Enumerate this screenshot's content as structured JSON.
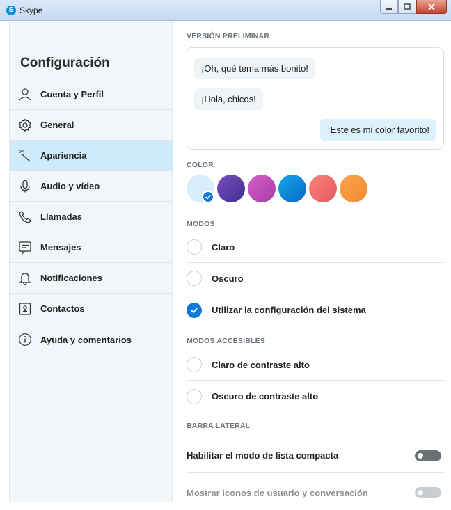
{
  "window": {
    "title": "Skype",
    "logo_letter": "S"
  },
  "sidebar": {
    "title": "Configuración",
    "items": [
      {
        "label": "Cuenta y Perfil",
        "icon": "person-icon"
      },
      {
        "label": "General",
        "icon": "gear-icon"
      },
      {
        "label": "Apariencia",
        "icon": "magic-wand-icon",
        "active": true
      },
      {
        "label": "Audio y vídeo",
        "icon": "microphone-icon"
      },
      {
        "label": "Llamadas",
        "icon": "phone-icon"
      },
      {
        "label": "Mensajes",
        "icon": "message-icon"
      },
      {
        "label": "Notificaciones",
        "icon": "bell-icon"
      },
      {
        "label": "Contactos",
        "icon": "contact-card-icon"
      },
      {
        "label": "Ayuda y comentarios",
        "icon": "info-icon"
      }
    ]
  },
  "preview": {
    "label": "VERSIÓN PRELIMINAR",
    "messages": [
      {
        "text": "¡Oh, qué tema más bonito!",
        "direction": "in"
      },
      {
        "text": "¡Hola, chicos!",
        "direction": "in"
      },
      {
        "text": "¡Este es mi color favorito!",
        "direction": "out"
      }
    ]
  },
  "color": {
    "label": "COLOR",
    "swatches": [
      {
        "color": "#d9eefb",
        "selected": true
      },
      {
        "color": "#5b3fa8"
      },
      {
        "color": "#c24cb8"
      },
      {
        "color": "#0a87d8"
      },
      {
        "color": "#ee6b6b"
      },
      {
        "color": "#f5973e"
      }
    ]
  },
  "modes": {
    "label": "MODOS",
    "options": [
      {
        "label": "Claro",
        "checked": false
      },
      {
        "label": "Oscuro",
        "checked": false
      },
      {
        "label": "Utilizar la configuración del sistema",
        "checked": true
      }
    ]
  },
  "accessible_modes": {
    "label": "MODOS ACCESIBLES",
    "options": [
      {
        "label": "Claro de contraste alto",
        "checked": false
      },
      {
        "label": "Oscuro de contraste alto",
        "checked": false
      }
    ]
  },
  "sidebar_settings": {
    "label": "BARRA LATERAL",
    "toggles": [
      {
        "label": "Habilitar el modo de lista compacta",
        "on": false,
        "disabled": false
      },
      {
        "label": "Mostrar iconos de usuario y conversación",
        "on": false,
        "disabled": true
      }
    ]
  },
  "colors": {
    "accent": "#0c7ad8",
    "active_nav": "#cfeafc",
    "sidebar_bg": "#f2f6f8"
  }
}
